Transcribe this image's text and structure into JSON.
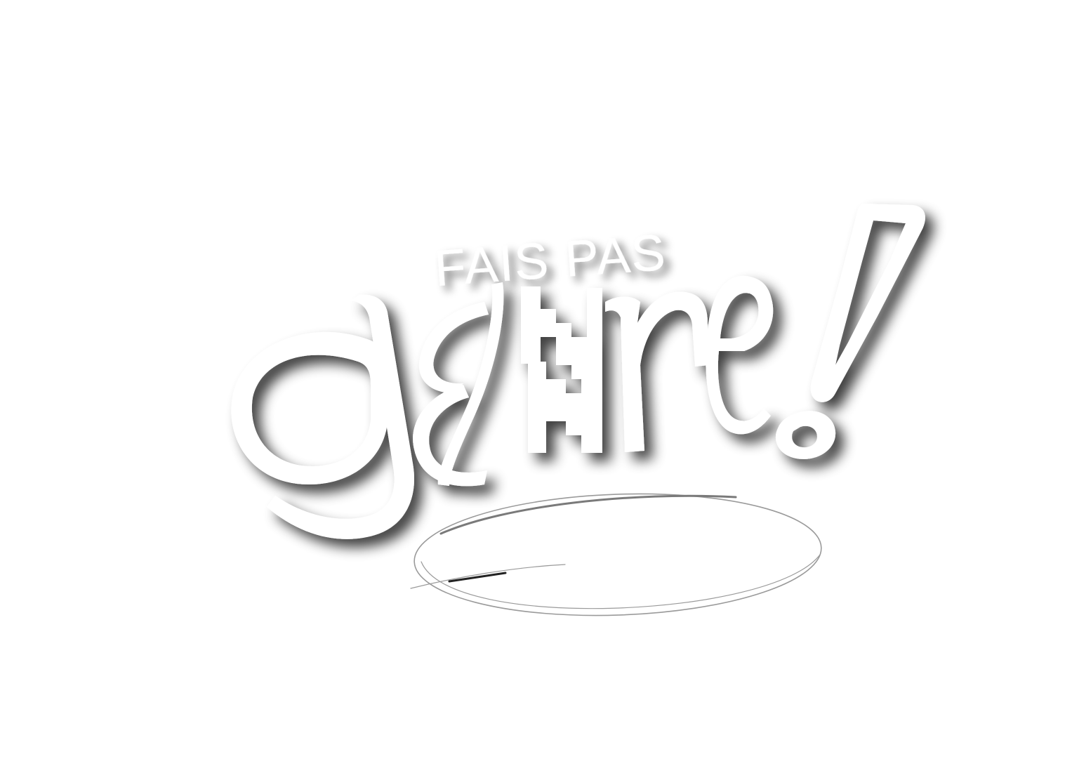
{
  "logo": {
    "line1": "FAIS PAS",
    "line2": "genre!",
    "fill_color": "#ffffff",
    "shadow_color": "#000000",
    "background_color": "#ffffff",
    "oval_stroke_color": "#9a9a9a"
  }
}
